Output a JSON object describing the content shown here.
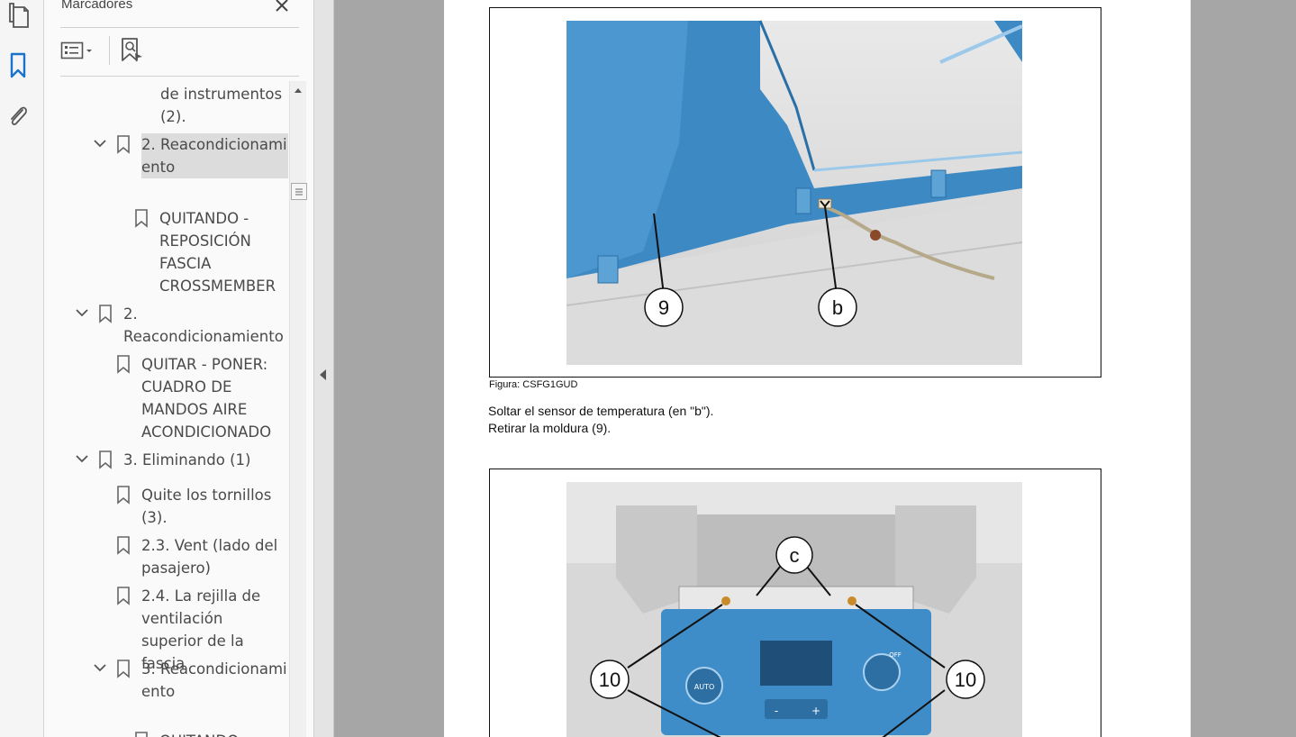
{
  "sidebar": {
    "title": "Marcadores",
    "rail_icons": [
      "pages-icon",
      "bookmark-icon",
      "attachment-icon"
    ],
    "bookmarks": [
      {
        "label": "de instrumentos (2).",
        "expanded": null,
        "selected": false
      },
      {
        "label": "2. Reacondicionamiento",
        "expanded": true,
        "selected": true
      },
      {
        "label": "QUITANDO - REPOSICIÓN FASCIA CROSSMEMBER",
        "expanded": null,
        "selected": false
      },
      {
        "label": "2. Reacondicionamiento",
        "expanded": true,
        "selected": false
      },
      {
        "label": "QUITAR - PONER: CUADRO DE MANDOS AIRE ACONDICIONADO",
        "expanded": null,
        "selected": false
      },
      {
        "label": "3. Eliminando (1)",
        "expanded": true,
        "selected": false
      },
      {
        "label": "Quite los tornillos (3).",
        "expanded": null,
        "selected": false
      },
      {
        "label": "2.3. Vent (lado del pasajero)",
        "expanded": null,
        "selected": false
      },
      {
        "label": "2.4. La rejilla de ventilación superior de la fascia",
        "expanded": null,
        "selected": false
      },
      {
        "label": "3. Reacondicionamiento",
        "expanded": true,
        "selected": false
      },
      {
        "label": "QUITANDO",
        "expanded": null,
        "selected": false
      }
    ]
  },
  "document": {
    "figure1": {
      "caption": "Figura: CSFG1GUD",
      "callouts": [
        "9",
        "b"
      ]
    },
    "paragraph": "Soltar el sensor de temperatura (en \"b\"). Retirar la moldura (9).",
    "figure2": {
      "callouts": [
        "c",
        "10",
        "10"
      ],
      "panel_labels": [
        "AUTO",
        "OFF",
        "-",
        "+"
      ]
    }
  },
  "colors": {
    "panel_bg": "#fafafa",
    "doc_bg": "#a6a6a6",
    "trim_blue": "#3d89c4",
    "selection": "#dcdcdc"
  }
}
